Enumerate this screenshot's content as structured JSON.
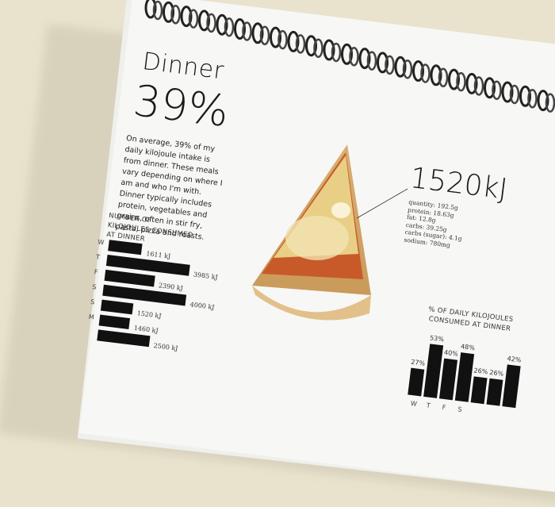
{
  "page": {
    "title": "Dinner",
    "percentage": "39%",
    "description": "On average, 39% of my daily kilojoule intake is from dinner. These meals vary depending on where I am and who I'm with. Dinner typically includes protein, vegetables and grains, often in stir fry, pasta, pizza and roasts."
  },
  "callout": {
    "energy": "1520kJ",
    "nutrition": [
      "quantity: 192.5g",
      "protein: 18.63g",
      "fat: 12.8g",
      "carbs: 39.25g",
      "carbs (sugar): 4.1g",
      "sodium: 780mg"
    ]
  },
  "chart_data": [
    {
      "type": "bar",
      "orientation": "horizontal",
      "title": "NUMBER OF KILOJOULES CONSUMED AT DINNER",
      "categories": [
        "W",
        "T",
        "F",
        "S",
        "S",
        "M",
        ""
      ],
      "values": [
        1611,
        3985,
        2390,
        4000,
        1520,
        1460,
        2500
      ],
      "labels": [
        "1611 kJ",
        "3985 kJ",
        "2390 kJ",
        "4000 kJ",
        "1520 kJ",
        "1460 kJ",
        "2500 kJ"
      ],
      "unit": "kJ"
    },
    {
      "type": "bar",
      "orientation": "vertical",
      "title": "% OF DAILY KILOJOULES CONSUMED AT DINNER",
      "categories": [
        "W",
        "T",
        "F",
        "S",
        "",
        "",
        ""
      ],
      "values": [
        27,
        53,
        40,
        48,
        26,
        26,
        42
      ],
      "labels": [
        "27%",
        "53%",
        "40%",
        "48%",
        "26%",
        "26%",
        "42%"
      ],
      "unit": "%"
    }
  ]
}
